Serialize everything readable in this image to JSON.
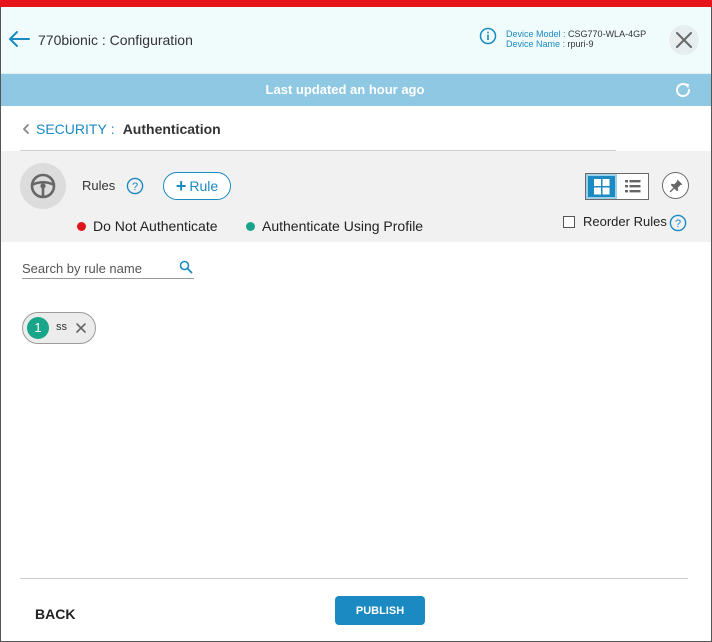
{
  "header": {
    "title": "770bionic : Configuration",
    "device_model_label": "Device Model :",
    "device_model": "CSG770-WLA-4GP",
    "device_name_label": "Device Name :",
    "device_name": "rpuri-9"
  },
  "banner": {
    "text": "Last updated an hour ago"
  },
  "breadcrumb": {
    "parent": "SECURITY",
    "separator": ":",
    "current": "Authentication"
  },
  "rules": {
    "label": "Rules",
    "add_label": "Rule",
    "legend": [
      {
        "label": "Do Not Authenticate",
        "color": "#e0141b"
      },
      {
        "label": "Authenticate Using Profile",
        "color": "#19a589"
      }
    ],
    "reorder_label": "Reorder Rules",
    "reorder_checked": false,
    "view_mode": "grid"
  },
  "search": {
    "placeholder": "Search by rule name",
    "value": ""
  },
  "rule_chips": [
    {
      "number": "1",
      "name": "ss",
      "color": "#19a589"
    }
  ],
  "footer": {
    "back_label": "BACK",
    "publish_label": "PUBLISH"
  },
  "colors": {
    "accent": "#1b8ac2",
    "top_stripe": "#e8141b",
    "banner": "#8ec8e2"
  }
}
